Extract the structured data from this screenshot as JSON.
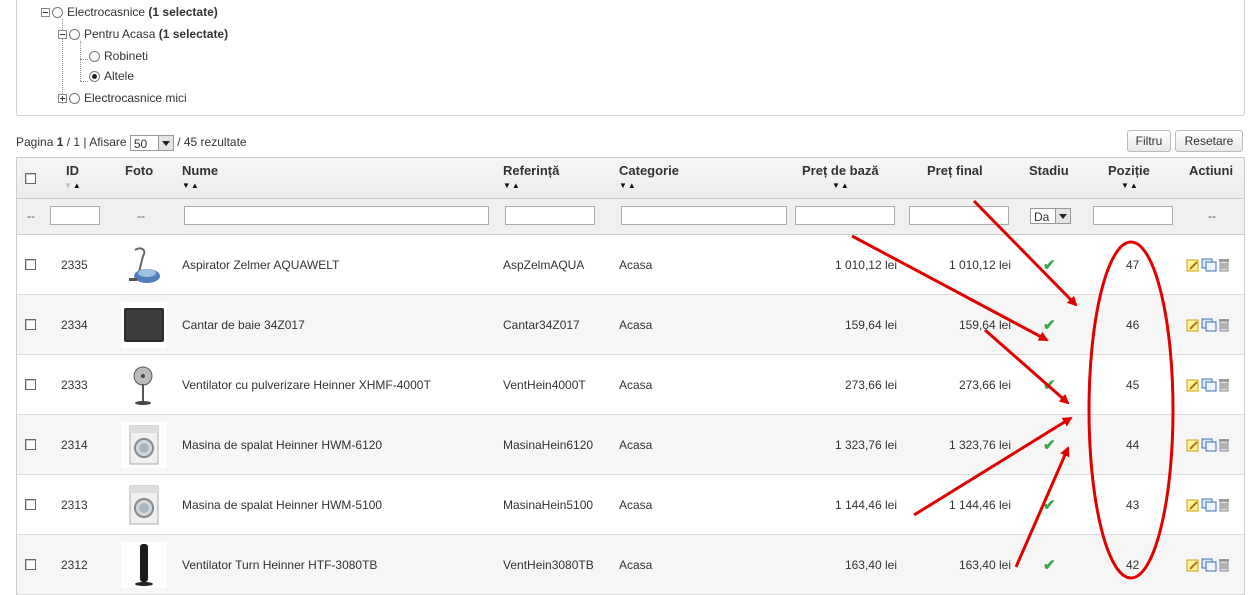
{
  "tree": {
    "root": {
      "label": "Electrocasnice",
      "bold": "(1 selectate)"
    },
    "child": {
      "label": "Pentru Acasa",
      "bold": "(1 selectate)"
    },
    "leaf1": {
      "label": "Robineti"
    },
    "leaf2": {
      "label": "Altele"
    },
    "sibling": {
      "label": "Electrocasnice mici"
    }
  },
  "pager": {
    "prefix": "Pagina ",
    "page": "1",
    "sep": " / 1 | Afisare ",
    "per_page": "50",
    "suffix": " / 45 rezultate"
  },
  "buttons": {
    "filter": "Filtru",
    "reset": "Resetare"
  },
  "columns": {
    "id": "ID",
    "photo": "Foto",
    "name": "Nume",
    "ref": "Referință",
    "category": "Categorie",
    "base_price": "Preț de bază",
    "final_price": "Preț final",
    "status": "Stadiu",
    "position": "Poziție",
    "actions": "Actiuni"
  },
  "filter_row": {
    "dash": "--",
    "status_value": "Da"
  },
  "rows": [
    {
      "id": "2335",
      "name": "Aspirator Zelmer AQUAWELT",
      "ref": "AspZelmAQUA",
      "category": "Acasa",
      "base_price": "1 010,12 lei",
      "final_price": "1 010,12 lei",
      "position": "47",
      "photo": "vacuum-photo"
    },
    {
      "id": "2334",
      "name": "Cantar de baie 34Z017",
      "ref": "Cantar34Z017",
      "category": "Acasa",
      "base_price": "159,64 lei",
      "final_price": "159,64 lei",
      "position": "46",
      "photo": "scale-photo"
    },
    {
      "id": "2333",
      "name": "Ventilator cu pulverizare Heinner XHMF-4000T",
      "ref": "VentHein4000T",
      "category": "Acasa",
      "base_price": "273,66 lei",
      "final_price": "273,66 lei",
      "position": "45",
      "photo": "fan-photo"
    },
    {
      "id": "2314",
      "name": "Masina de spalat Heinner HWM-6120",
      "ref": "MasinaHein6120",
      "category": "Acasa",
      "base_price": "1 323,76 lei",
      "final_price": "1 323,76 lei",
      "position": "44",
      "photo": "washer-photo"
    },
    {
      "id": "2313",
      "name": "Masina de spalat Heinner HWM-5100",
      "ref": "MasinaHein5100",
      "category": "Acasa",
      "base_price": "1 144,46 lei",
      "final_price": "1 144,46 lei",
      "position": "43",
      "photo": "washer-photo"
    },
    {
      "id": "2312",
      "name": "Ventilator Turn Heinner HTF-3080TB",
      "ref": "VentHein3080TB",
      "category": "Acasa",
      "base_price": "163,40 lei",
      "final_price": "163,40 lei",
      "position": "42",
      "photo": "tower-fan-photo"
    }
  ],
  "annotation_color": "#e00000"
}
